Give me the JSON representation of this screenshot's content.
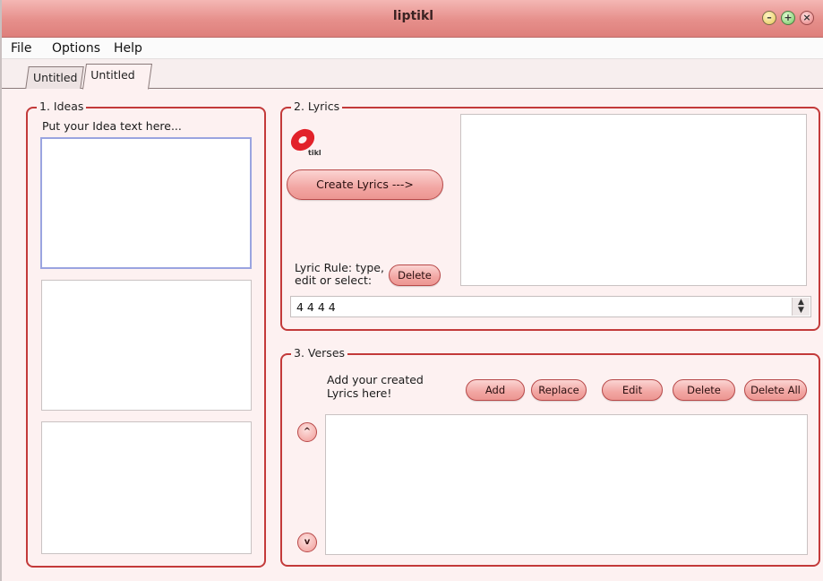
{
  "window": {
    "title": "liptikl"
  },
  "menu": {
    "file": "File",
    "options": "Options",
    "help": "Help"
  },
  "tabs": [
    {
      "label": "Untitled"
    },
    {
      "label": "Untitled"
    }
  ],
  "ideas": {
    "legend": "1. Ideas",
    "prompt": "Put your Idea text here..."
  },
  "lyrics": {
    "legend": "2. Lyrics",
    "logo_text": "tikl",
    "create_button": "Create Lyrics --->",
    "rule_label_line1": "Lyric Rule: type,",
    "rule_label_line2": "edit or select:",
    "delete_button": "Delete",
    "rule_value": "4 4 4 4"
  },
  "verses": {
    "legend": "3. Verses",
    "hint_line1": "Add your created",
    "hint_line2": "Lyrics here!",
    "add_button": "Add",
    "replace_button": "Replace",
    "edit_button": "Edit",
    "delete_button": "Delete",
    "delete_all_button": "Delete All",
    "up_glyph": "^",
    "down_glyph": "v"
  },
  "colors": {
    "accent": "#c33a3a",
    "titlebar": "#e68f8b",
    "button": "#f2a6a3"
  }
}
